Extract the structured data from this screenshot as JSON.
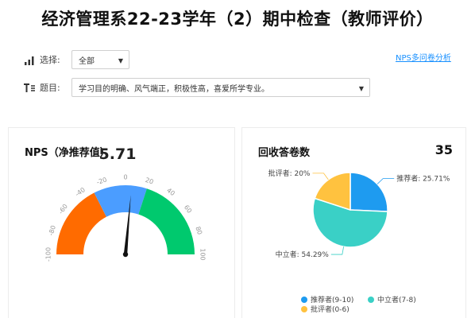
{
  "title": "经济管理系22-23学年（2）期中检查（教师评价）",
  "filters": {
    "select_label": "选择:",
    "select_value": "全部",
    "question_label": "题目:",
    "question_value": "学习目的明确、风气端正，积极性高，喜爱所学专业。"
  },
  "links": {
    "nps_analysis": "NPS多问卷分析"
  },
  "nps_card": {
    "title": "NPS（净推荐值）",
    "value": "5.71",
    "gauge_ticks": [
      "-100",
      "-80",
      "-60",
      "-40",
      "-20",
      "0",
      "20",
      "40",
      "60",
      "80",
      "100"
    ],
    "needle_value": 5.71,
    "colors": {
      "detractor": "#ff6b00",
      "passive": "#4b9dff",
      "promoter": "#00c96e"
    }
  },
  "response_card": {
    "title": "回收答卷数",
    "count": "35"
  },
  "chart_data": {
    "type": "pie",
    "title": "",
    "slices": [
      {
        "name": "推荐者(9-10)",
        "label": "推荐者: 25.71%",
        "value": 25.71,
        "color": "#1e9bf0"
      },
      {
        "name": "中立者(7-8)",
        "label": "中立者: 54.29%",
        "value": 54.29,
        "color": "#3ad0c6"
      },
      {
        "name": "批评者(0-6)",
        "label": "批评者: 20%",
        "value": 20,
        "color": "#ffc23f"
      }
    ],
    "legend_position": "bottom"
  }
}
